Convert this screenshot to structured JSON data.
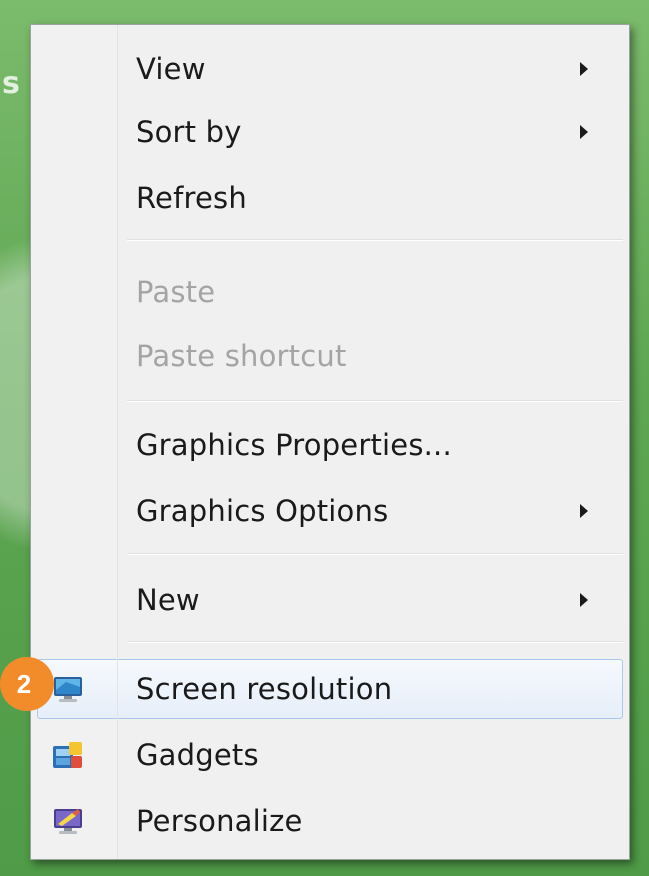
{
  "desktop": {
    "glyph": "s"
  },
  "menu": {
    "items": [
      {
        "label": "View",
        "submenu": true
      },
      {
        "label": "Sort by",
        "submenu": true
      },
      {
        "label": "Refresh"
      },
      {
        "label": "Paste",
        "disabled": true
      },
      {
        "label": "Paste shortcut",
        "disabled": true
      },
      {
        "label": "Graphics Properties..."
      },
      {
        "label": "Graphics Options",
        "submenu": true
      },
      {
        "label": "New",
        "submenu": true
      },
      {
        "label": "Screen resolution",
        "icon": "monitor-icon",
        "highlighted": true
      },
      {
        "label": "Gadgets",
        "icon": "gadgets-icon"
      },
      {
        "label": "Personalize",
        "icon": "personalize-icon"
      }
    ]
  },
  "callout": {
    "number": "2",
    "color": "#f28c2a"
  },
  "colors": {
    "highlight_border": "#a9c8ea",
    "disabled_text": "#a4a4a4"
  }
}
